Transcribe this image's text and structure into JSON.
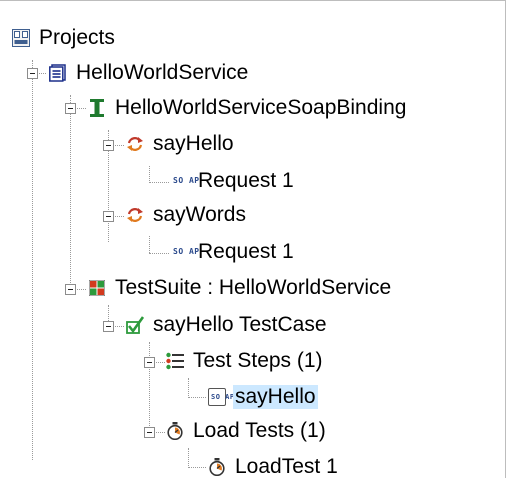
{
  "tree": {
    "root": {
      "label": "Projects",
      "icon": "projects-icon"
    },
    "project": {
      "label": "HelloWorldService",
      "icon": "project-icon"
    },
    "interface": {
      "label": "HelloWorldServiceSoapBinding",
      "icon": "interface-icon"
    },
    "operations": [
      {
        "label": "sayHello",
        "icon": "operation-icon",
        "request": {
          "label": "Request 1",
          "icon": "soap-request-icon"
        }
      },
      {
        "label": "sayWords",
        "icon": "operation-icon",
        "request": {
          "label": "Request 1",
          "icon": "soap-request-icon"
        }
      }
    ],
    "testsuite": {
      "label": "TestSuite : HelloWorldService",
      "icon": "testsuite-icon"
    },
    "testcase": {
      "label": "sayHello TestCase",
      "icon": "testcase-icon"
    },
    "teststeps": {
      "label": "Test Steps (1)",
      "icon": "teststeps-icon",
      "step": {
        "label": "sayHello",
        "icon": "soap-teststep-icon",
        "selected": true
      }
    },
    "loadtests": {
      "label": "Load Tests (1)",
      "icon": "loadtests-icon",
      "test": {
        "label": "LoadTest 1",
        "icon": "loadtest-icon"
      }
    }
  },
  "soap_icon_text": "SO AP",
  "colors": {
    "selection": "#cce8ff",
    "operation": "#c0392b",
    "interface": "#1f7a2e",
    "testsuite_red": "#d23a1e",
    "testsuite_green": "#2d9a3c",
    "testcase": "#2d9a3c"
  }
}
